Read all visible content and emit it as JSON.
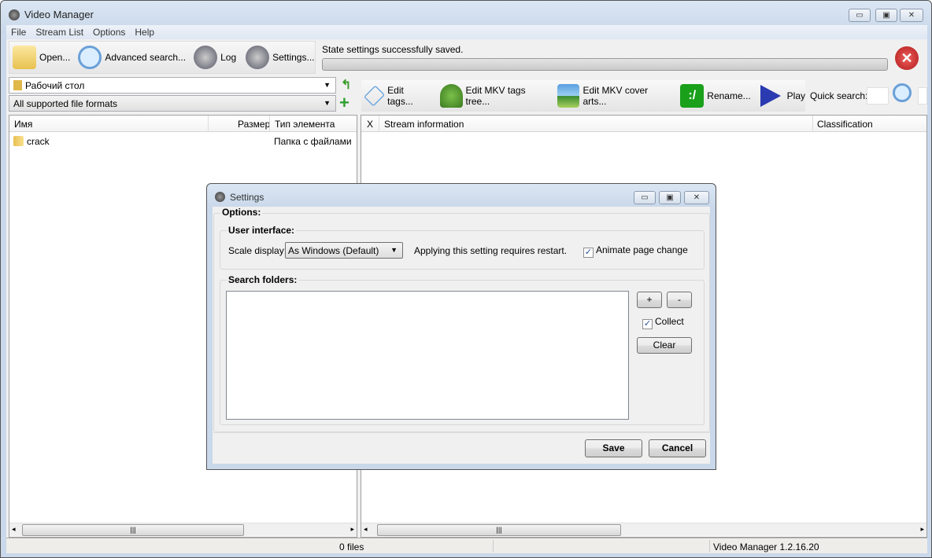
{
  "window": {
    "title": "Video Manager",
    "minimize": "▭",
    "maximize": "▣",
    "close": "✕"
  },
  "menu": [
    "File",
    "Stream List",
    "Options",
    "Help"
  ],
  "toolbar": {
    "open": "Open...",
    "advanced_search": "Advanced search...",
    "log": "Log",
    "settings": "Settings..."
  },
  "status": {
    "message": "State settings successfully saved.",
    "progress": 0
  },
  "left": {
    "location": "Рабочий стол",
    "filter": "All supported file formats",
    "columns": [
      "Имя",
      "Размер",
      "Тип элемента"
    ],
    "rows": [
      {
        "name": "crack",
        "size": "",
        "type": "Папка с файлами"
      }
    ]
  },
  "right": {
    "toolbar": {
      "edit_tags": "Edit tags...",
      "edit_mkv_tree": "Edit MKV tags tree...",
      "edit_mkv_cover": "Edit MKV cover arts...",
      "rename": "Rename...",
      "play": "Play",
      "quick_search": "Quick search:"
    },
    "columns": [
      "X",
      "Stream information",
      "Classification"
    ]
  },
  "statusbar": {
    "files": "0 files",
    "version": "Video Manager 1.2.16.20"
  },
  "dialog": {
    "title": "Settings",
    "options": "Options:",
    "ui_group": "User interface:",
    "scale_label": "Scale display:",
    "scale_value": "As Windows (Default)",
    "restart_note": "Applying this setting requires restart.",
    "animate": "Animate page change",
    "animate_checked": true,
    "search_group": "Search folders:",
    "add": "+",
    "remove": "-",
    "collect": "Collect",
    "collect_checked": true,
    "clear": "Clear",
    "save": "Save",
    "cancel": "Cancel"
  },
  "colors": {
    "accent": "#3a7bd5",
    "close_red": "#d22a2a",
    "rename_green": "#1aa01a"
  }
}
